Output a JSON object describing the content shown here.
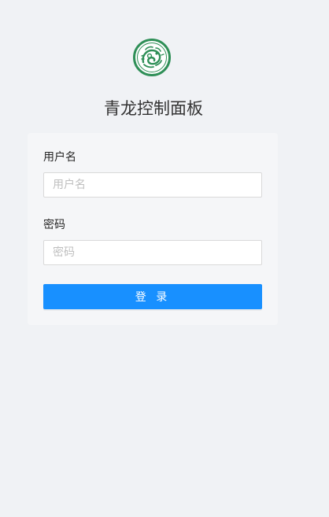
{
  "app": {
    "title": "青龙控制面板",
    "logo_icon": "qinglong-dragon-logo-icon"
  },
  "login_form": {
    "username_label": "用户名",
    "username_placeholder": "用户名",
    "username_value": "",
    "password_label": "密码",
    "password_placeholder": "密码",
    "password_value": "",
    "submit_label": "登 录"
  },
  "colors": {
    "background": "#f0f2f5",
    "card": "#f5f6f8",
    "primary": "#1890ff",
    "logo_green": "#2e8b57"
  }
}
